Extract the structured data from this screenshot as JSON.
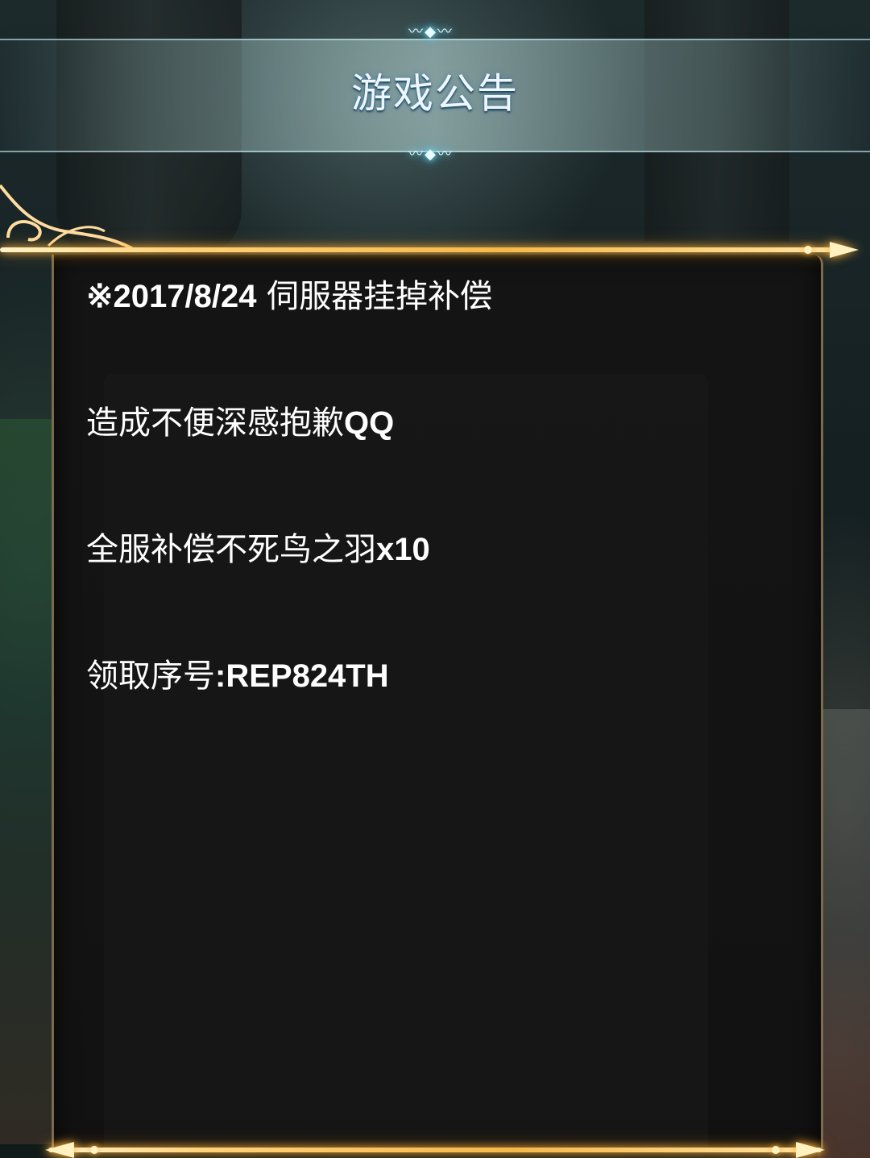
{
  "dialog": {
    "title": "游戏公告",
    "title_ornament_icon": "ornament-icon"
  },
  "announcement": {
    "lines": [
      {
        "prefix": "※",
        "bold": "2017/8/24",
        "text": " 伺服器挂掉补偿"
      },
      {
        "text": "造成不便深感抱歉",
        "bold": "QQ"
      },
      {
        "text": "全服补偿不死鸟之羽",
        "bold": "x10"
      },
      {
        "text": "领取序号",
        "bold": ":REP824TH"
      }
    ]
  },
  "colors": {
    "frame_gold": "#ffd27a",
    "title_glow": "#7fe6ff",
    "panel_bg": "#141414",
    "text": "#ffffff"
  }
}
